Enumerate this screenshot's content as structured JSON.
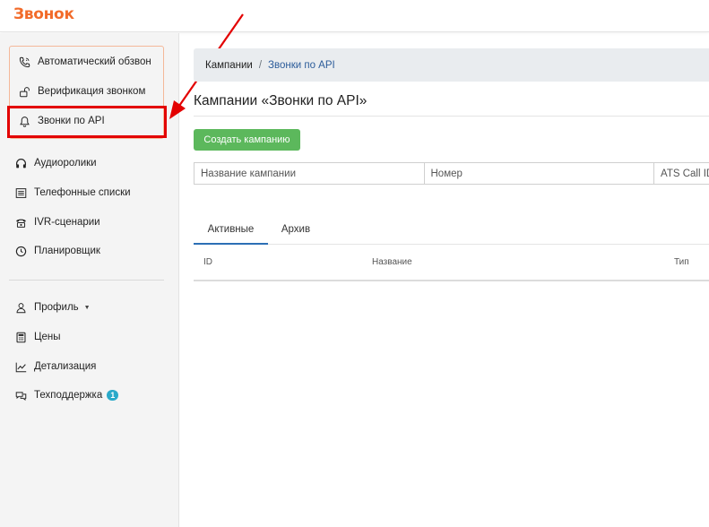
{
  "app": {
    "logo": "Звонок"
  },
  "sidebar": {
    "items": [
      {
        "label": "Автоматический обзвон",
        "icon": "phone-call-icon"
      },
      {
        "label": "Верификация звонком",
        "icon": "unlock-icon"
      },
      {
        "label": "Звонки по API",
        "icon": "bell-icon"
      },
      {
        "label": "Аудиоролики",
        "icon": "headphones-icon"
      },
      {
        "label": "Телефонные списки",
        "icon": "list-icon"
      },
      {
        "label": "IVR-сценарии",
        "icon": "desk-phone-icon"
      },
      {
        "label": "Планировщик",
        "icon": "clock-icon"
      }
    ],
    "bottom_items": [
      {
        "label": "Профиль",
        "icon": "user-icon"
      },
      {
        "label": "Цены",
        "icon": "calculator-icon"
      },
      {
        "label": "Детализация",
        "icon": "chart-line-icon"
      },
      {
        "label": "Техподдержка",
        "icon": "chat-icon",
        "badge": "1"
      }
    ]
  },
  "breadcrumb": {
    "root": "Кампании",
    "separator": "/",
    "current": "Звонки по API"
  },
  "page": {
    "title": "Кампании «Звонки по API»"
  },
  "toolbar": {
    "create_label": "Создать кампанию"
  },
  "filters": {
    "name_placeholder": "Название кампании",
    "number_placeholder": "Номер",
    "ats_placeholder": "ATS Call ID"
  },
  "tabs": [
    {
      "label": "Активные"
    },
    {
      "label": "Архив"
    }
  ],
  "table": {
    "columns": [
      "ID",
      "Название",
      "Тип"
    ]
  },
  "colors": {
    "brand": "#f26b2a",
    "accent": "#2c6fb5",
    "success": "#5cb85c",
    "highlight": "#e30000",
    "badge": "#2aa9c9"
  }
}
